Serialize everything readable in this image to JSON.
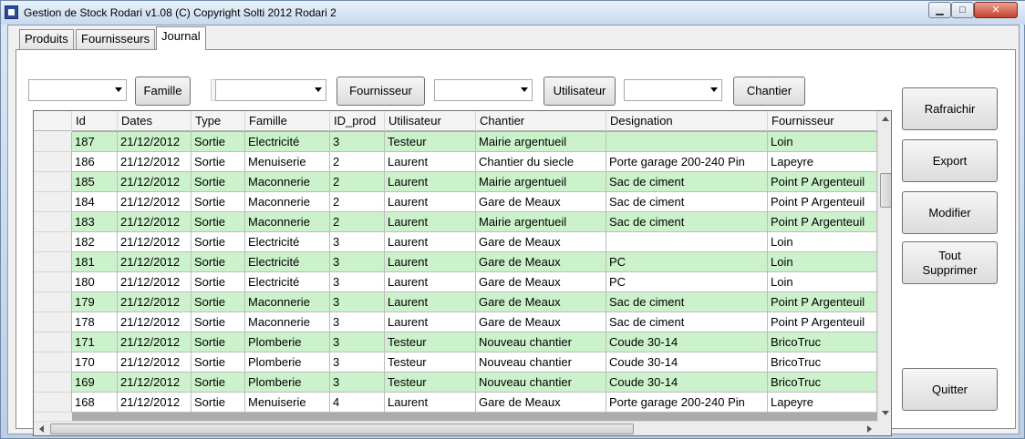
{
  "window": {
    "title": "Gestion de Stock Rodari v1.08 (C) Copyright Solti 2012 Rodari 2",
    "minimize_glyph": "▁",
    "maximize_glyph": "□",
    "close_glyph": "✕"
  },
  "tabs": [
    {
      "label": "Produits",
      "active": false
    },
    {
      "label": "Fournisseurs",
      "active": false
    },
    {
      "label": "Journal",
      "active": true
    }
  ],
  "filters": {
    "famille_value": "",
    "fournisseur_value": "",
    "utilisateur_value": "",
    "chantier_value": "",
    "famille_button": "Famille",
    "fournisseur_button": "Fournisseur",
    "utilisateur_button": "Utilisateur",
    "chantier_button": "Chantier"
  },
  "grid": {
    "columns": [
      "Id",
      "Dates",
      "Type",
      "Famille",
      "ID_prod",
      "Utilisateur",
      "Chantier",
      "Designation",
      "Fournisseur"
    ],
    "rows": [
      [
        "187",
        "21/12/2012",
        "Sortie",
        "Electricité",
        "3",
        "Testeur",
        "Mairie argentueil",
        "",
        "Loin"
      ],
      [
        "186",
        "21/12/2012",
        "Sortie",
        "Menuiserie",
        "2",
        "Laurent",
        "Chantier du siecle",
        "Porte garage 200-240 Pin",
        "Lapeyre"
      ],
      [
        "185",
        "21/12/2012",
        "Sortie",
        "Maconnerie",
        "2",
        "Laurent",
        "Mairie argentueil",
        "Sac de ciment",
        "Point P Argenteuil"
      ],
      [
        "184",
        "21/12/2012",
        "Sortie",
        "Maconnerie",
        "2",
        "Laurent",
        "Gare de Meaux",
        "Sac de ciment",
        "Point P Argenteuil"
      ],
      [
        "183",
        "21/12/2012",
        "Sortie",
        "Maconnerie",
        "2",
        "Laurent",
        "Mairie argentueil",
        "Sac de ciment",
        "Point P Argenteuil"
      ],
      [
        "182",
        "21/12/2012",
        "Sortie",
        "Electricité",
        "3",
        "Laurent",
        "Gare de Meaux",
        "",
        "Loin"
      ],
      [
        "181",
        "21/12/2012",
        "Sortie",
        "Electricité",
        "3",
        "Laurent",
        "Gare de Meaux",
        "PC",
        "Loin"
      ],
      [
        "180",
        "21/12/2012",
        "Sortie",
        "Electricité",
        "3",
        "Laurent",
        "Gare de Meaux",
        "PC",
        "Loin"
      ],
      [
        "179",
        "21/12/2012",
        "Sortie",
        "Maconnerie",
        "3",
        "Laurent",
        "Gare de Meaux",
        "Sac de ciment",
        "Point P Argenteuil"
      ],
      [
        "178",
        "21/12/2012",
        "Sortie",
        "Maconnerie",
        "3",
        "Laurent",
        "Gare de Meaux",
        "Sac de ciment",
        "Point P Argenteuil"
      ],
      [
        "171",
        "21/12/2012",
        "Sortie",
        "Plomberie",
        "3",
        "Testeur",
        "Nouveau chantier",
        "Coude 30-14",
        "BricoTruc"
      ],
      [
        "170",
        "21/12/2012",
        "Sortie",
        "Plomberie",
        "3",
        "Testeur",
        "Nouveau chantier",
        "Coude 30-14",
        "BricoTruc"
      ],
      [
        "169",
        "21/12/2012",
        "Sortie",
        "Plomberie",
        "3",
        "Testeur",
        "Nouveau chantier",
        "Coude 30-14",
        "BricoTruc"
      ],
      [
        "168",
        "21/12/2012",
        "Sortie",
        "Menuiserie",
        "4",
        "Laurent",
        "Gare de Meaux",
        "Porte garage 200-240 Pin",
        "Lapeyre"
      ]
    ],
    "row_colors": [
      "#cbf2cb",
      "#ffffff"
    ]
  },
  "side_buttons": {
    "rafraichir": "Rafraichir",
    "export": "Export",
    "modifier": "Modifier",
    "tout_supprimer": "Tout Supprimer",
    "quitter": "Quitter"
  }
}
